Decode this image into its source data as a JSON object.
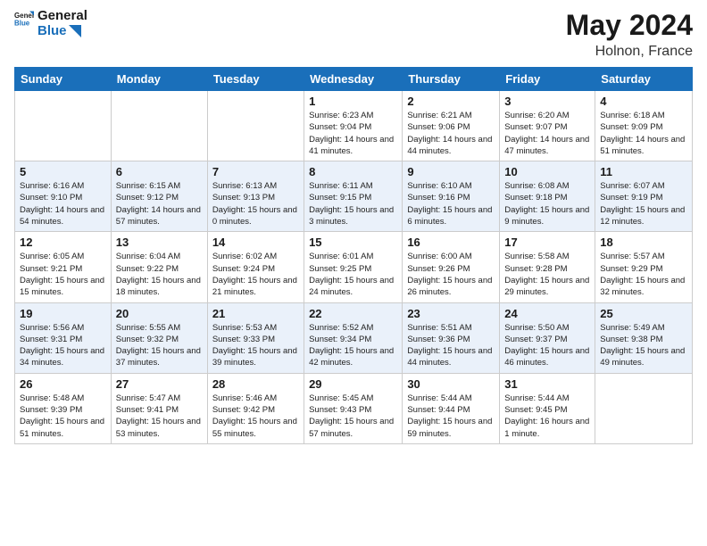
{
  "header": {
    "logo_line1": "General",
    "logo_line2": "Blue",
    "month": "May 2024",
    "location": "Holnon, France"
  },
  "weekdays": [
    "Sunday",
    "Monday",
    "Tuesday",
    "Wednesday",
    "Thursday",
    "Friday",
    "Saturday"
  ],
  "weeks": [
    [
      {
        "day": "",
        "sunrise": "",
        "sunset": "",
        "daylight": ""
      },
      {
        "day": "",
        "sunrise": "",
        "sunset": "",
        "daylight": ""
      },
      {
        "day": "",
        "sunrise": "",
        "sunset": "",
        "daylight": ""
      },
      {
        "day": "1",
        "sunrise": "Sunrise: 6:23 AM",
        "sunset": "Sunset: 9:04 PM",
        "daylight": "Daylight: 14 hours and 41 minutes."
      },
      {
        "day": "2",
        "sunrise": "Sunrise: 6:21 AM",
        "sunset": "Sunset: 9:06 PM",
        "daylight": "Daylight: 14 hours and 44 minutes."
      },
      {
        "day": "3",
        "sunrise": "Sunrise: 6:20 AM",
        "sunset": "Sunset: 9:07 PM",
        "daylight": "Daylight: 14 hours and 47 minutes."
      },
      {
        "day": "4",
        "sunrise": "Sunrise: 6:18 AM",
        "sunset": "Sunset: 9:09 PM",
        "daylight": "Daylight: 14 hours and 51 minutes."
      }
    ],
    [
      {
        "day": "5",
        "sunrise": "Sunrise: 6:16 AM",
        "sunset": "Sunset: 9:10 PM",
        "daylight": "Daylight: 14 hours and 54 minutes."
      },
      {
        "day": "6",
        "sunrise": "Sunrise: 6:15 AM",
        "sunset": "Sunset: 9:12 PM",
        "daylight": "Daylight: 14 hours and 57 minutes."
      },
      {
        "day": "7",
        "sunrise": "Sunrise: 6:13 AM",
        "sunset": "Sunset: 9:13 PM",
        "daylight": "Daylight: 15 hours and 0 minutes."
      },
      {
        "day": "8",
        "sunrise": "Sunrise: 6:11 AM",
        "sunset": "Sunset: 9:15 PM",
        "daylight": "Daylight: 15 hours and 3 minutes."
      },
      {
        "day": "9",
        "sunrise": "Sunrise: 6:10 AM",
        "sunset": "Sunset: 9:16 PM",
        "daylight": "Daylight: 15 hours and 6 minutes."
      },
      {
        "day": "10",
        "sunrise": "Sunrise: 6:08 AM",
        "sunset": "Sunset: 9:18 PM",
        "daylight": "Daylight: 15 hours and 9 minutes."
      },
      {
        "day": "11",
        "sunrise": "Sunrise: 6:07 AM",
        "sunset": "Sunset: 9:19 PM",
        "daylight": "Daylight: 15 hours and 12 minutes."
      }
    ],
    [
      {
        "day": "12",
        "sunrise": "Sunrise: 6:05 AM",
        "sunset": "Sunset: 9:21 PM",
        "daylight": "Daylight: 15 hours and 15 minutes."
      },
      {
        "day": "13",
        "sunrise": "Sunrise: 6:04 AM",
        "sunset": "Sunset: 9:22 PM",
        "daylight": "Daylight: 15 hours and 18 minutes."
      },
      {
        "day": "14",
        "sunrise": "Sunrise: 6:02 AM",
        "sunset": "Sunset: 9:24 PM",
        "daylight": "Daylight: 15 hours and 21 minutes."
      },
      {
        "day": "15",
        "sunrise": "Sunrise: 6:01 AM",
        "sunset": "Sunset: 9:25 PM",
        "daylight": "Daylight: 15 hours and 24 minutes."
      },
      {
        "day": "16",
        "sunrise": "Sunrise: 6:00 AM",
        "sunset": "Sunset: 9:26 PM",
        "daylight": "Daylight: 15 hours and 26 minutes."
      },
      {
        "day": "17",
        "sunrise": "Sunrise: 5:58 AM",
        "sunset": "Sunset: 9:28 PM",
        "daylight": "Daylight: 15 hours and 29 minutes."
      },
      {
        "day": "18",
        "sunrise": "Sunrise: 5:57 AM",
        "sunset": "Sunset: 9:29 PM",
        "daylight": "Daylight: 15 hours and 32 minutes."
      }
    ],
    [
      {
        "day": "19",
        "sunrise": "Sunrise: 5:56 AM",
        "sunset": "Sunset: 9:31 PM",
        "daylight": "Daylight: 15 hours and 34 minutes."
      },
      {
        "day": "20",
        "sunrise": "Sunrise: 5:55 AM",
        "sunset": "Sunset: 9:32 PM",
        "daylight": "Daylight: 15 hours and 37 minutes."
      },
      {
        "day": "21",
        "sunrise": "Sunrise: 5:53 AM",
        "sunset": "Sunset: 9:33 PM",
        "daylight": "Daylight: 15 hours and 39 minutes."
      },
      {
        "day": "22",
        "sunrise": "Sunrise: 5:52 AM",
        "sunset": "Sunset: 9:34 PM",
        "daylight": "Daylight: 15 hours and 42 minutes."
      },
      {
        "day": "23",
        "sunrise": "Sunrise: 5:51 AM",
        "sunset": "Sunset: 9:36 PM",
        "daylight": "Daylight: 15 hours and 44 minutes."
      },
      {
        "day": "24",
        "sunrise": "Sunrise: 5:50 AM",
        "sunset": "Sunset: 9:37 PM",
        "daylight": "Daylight: 15 hours and 46 minutes."
      },
      {
        "day": "25",
        "sunrise": "Sunrise: 5:49 AM",
        "sunset": "Sunset: 9:38 PM",
        "daylight": "Daylight: 15 hours and 49 minutes."
      }
    ],
    [
      {
        "day": "26",
        "sunrise": "Sunrise: 5:48 AM",
        "sunset": "Sunset: 9:39 PM",
        "daylight": "Daylight: 15 hours and 51 minutes."
      },
      {
        "day": "27",
        "sunrise": "Sunrise: 5:47 AM",
        "sunset": "Sunset: 9:41 PM",
        "daylight": "Daylight: 15 hours and 53 minutes."
      },
      {
        "day": "28",
        "sunrise": "Sunrise: 5:46 AM",
        "sunset": "Sunset: 9:42 PM",
        "daylight": "Daylight: 15 hours and 55 minutes."
      },
      {
        "day": "29",
        "sunrise": "Sunrise: 5:45 AM",
        "sunset": "Sunset: 9:43 PM",
        "daylight": "Daylight: 15 hours and 57 minutes."
      },
      {
        "day": "30",
        "sunrise": "Sunrise: 5:44 AM",
        "sunset": "Sunset: 9:44 PM",
        "daylight": "Daylight: 15 hours and 59 minutes."
      },
      {
        "day": "31",
        "sunrise": "Sunrise: 5:44 AM",
        "sunset": "Sunset: 9:45 PM",
        "daylight": "Daylight: 16 hours and 1 minute."
      },
      {
        "day": "",
        "sunrise": "",
        "sunset": "",
        "daylight": ""
      }
    ]
  ]
}
